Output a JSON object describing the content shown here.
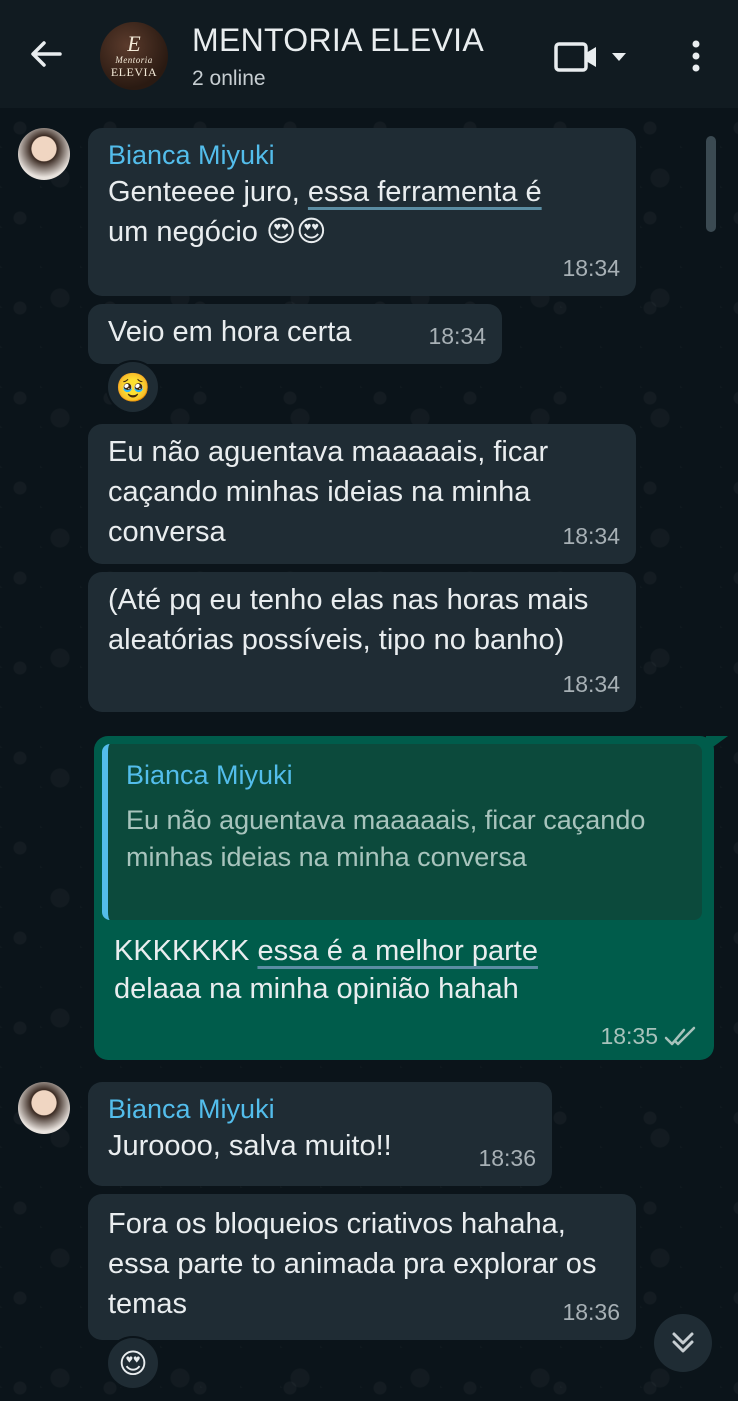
{
  "header": {
    "title": "MENTORIA ELEVIA",
    "status": "2 online",
    "avatar_monogram": "E",
    "avatar_small": "Mentoria",
    "avatar_brand": "ELEVIA"
  },
  "messages": [
    {
      "sender": "Bianca Miyuki",
      "text_a": "Genteeee juro, ",
      "text_link": "essa ferramenta é",
      "text_b": "um negócio 😍😍",
      "time": "18:34"
    },
    {
      "text": "Veio em hora certa",
      "time": "18:34",
      "reaction": "🥹"
    },
    {
      "text": "Eu não aguentava maaaaais, ficar caçando minhas ideias na minha conversa",
      "time": "18:34"
    },
    {
      "text": "(Até pq eu tenho elas nas horas mais aleatórias possíveis, tipo no banho)",
      "time": "18:34"
    }
  ],
  "outgoing": {
    "quote_sender": "Bianca Miyuki",
    "quote_text": "Eu não aguentava maaaaais, ficar caçando minhas ideias na minha conversa",
    "text_a": "KKKKKKK ",
    "text_link": "essa é a melhor parte",
    "text_b": "delaaa na minha opinião hahah",
    "time": "18:35"
  },
  "messages2": [
    {
      "sender": "Bianca Miyuki",
      "text": "Juroooo, salva muito!!",
      "time": "18:36"
    },
    {
      "text": "Fora os bloqueios criativos hahaha, essa parte to animada pra explorar os temas",
      "time": "18:36",
      "reaction": "😍"
    }
  ],
  "icons": {
    "back": "arrow-left-icon",
    "video": "video-call-icon",
    "menu": "more-vert-icon",
    "scroll": "double-chevron-down-icon"
  },
  "colors": {
    "header": "#111b21",
    "bg": "#0b141a",
    "incoming": "#1f2c34",
    "outgoing": "#005c4b",
    "sender": "#53bdeb"
  }
}
